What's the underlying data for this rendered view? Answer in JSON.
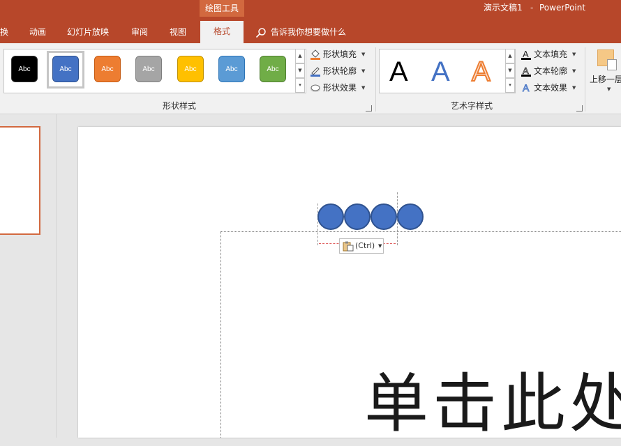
{
  "window": {
    "contextual_group": "绘图工具",
    "doc_name": "演示文稿1",
    "separator": "-",
    "app_name": "PowerPoint"
  },
  "tabs": [
    "换",
    "动画",
    "幻灯片放映",
    "审阅",
    "视图"
  ],
  "active_tab": "格式",
  "tell_me": "告诉我你想要做什么",
  "shape_styles": {
    "group_label": "形状样式",
    "swatches": [
      {
        "label": "Abc",
        "fill": "#000000",
        "text": "#ffffff"
      },
      {
        "label": "Abc",
        "fill": "#4472c4",
        "text": "#ffffff"
      },
      {
        "label": "Abc",
        "fill": "#ed7d31",
        "text": "#ffffff"
      },
      {
        "label": "Abc",
        "fill": "#a5a5a5",
        "text": "#ffffff"
      },
      {
        "label": "Abc",
        "fill": "#ffc000",
        "text": "#ffffff"
      },
      {
        "label": "Abc",
        "fill": "#5b9bd5",
        "text": "#ffffff"
      },
      {
        "label": "Abc",
        "fill": "#70ad47",
        "text": "#ffffff"
      }
    ],
    "selected_index": 1,
    "fill": "形状填充",
    "outline": "形状轮廓",
    "effects": "形状效果"
  },
  "wordart_styles": {
    "group_label": "艺术字样式",
    "letters": [
      "A",
      "A",
      "A"
    ],
    "text_fill": "文本填充",
    "text_outline": "文本轮廓",
    "text_effects": "文本效果"
  },
  "arrange": {
    "bring_forward": "上移一层"
  },
  "slide": {
    "title_placeholder": "单击此处",
    "shape_color": "#4472c4",
    "shape_count": 4,
    "paste_options": "(Ctrl)"
  },
  "colors": {
    "accent": "#b7472a",
    "ribbon": "#f1f1f1"
  }
}
